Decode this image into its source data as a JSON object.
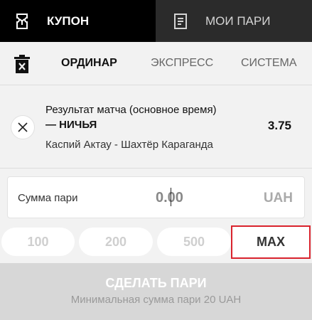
{
  "top_tabs": {
    "coupon": {
      "label": "КУПОН",
      "icon": "coupon-icon"
    },
    "my_bets": {
      "label": "МОИ ПАРИ",
      "icon": "document-icon"
    }
  },
  "sub_tabs": [
    {
      "label": "ОРДИНАР",
      "active": true
    },
    {
      "label": "ЭКСПРЕСС",
      "active": false
    },
    {
      "label": "СИСТЕМА",
      "active": false
    }
  ],
  "bet": {
    "market": "Результат матча (основное время)",
    "outcome": "— НИЧЬЯ",
    "odds": "3.75",
    "event": "Каспий Актау - Шахтёр Караганда"
  },
  "stake": {
    "label": "Сумма пари",
    "value": "0.00",
    "currency": "UAH"
  },
  "quick_amounts": [
    "100",
    "200",
    "500",
    "MAX"
  ],
  "submit": {
    "title": "СДЕЛАТЬ ПАРИ",
    "subtitle": "Минимальная сумма пари 20 UAH"
  },
  "colors": {
    "active_tab_bg": "#000000",
    "inactive_tab_bg": "#2b2b2b",
    "highlight": "#d9232d"
  }
}
